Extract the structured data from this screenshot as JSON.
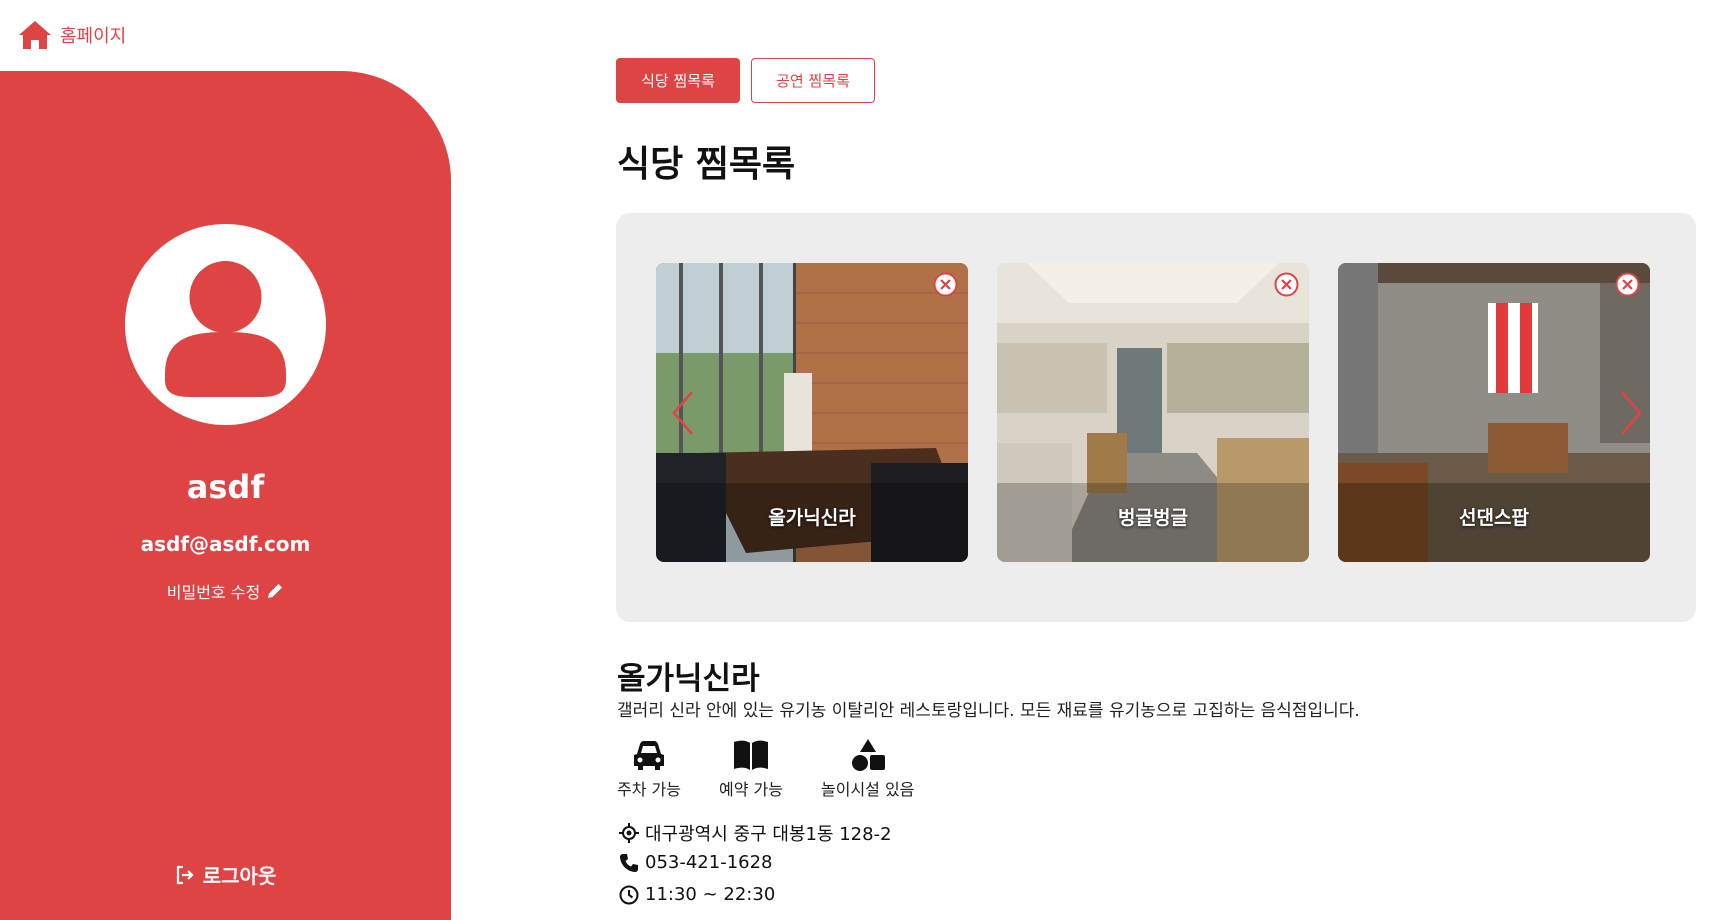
{
  "nav": {
    "home_label": "홈페이지",
    "home_icon": "home-icon",
    "accent_color": "#de4444"
  },
  "profile": {
    "username": "asdf",
    "email": "asdf@asdf.com",
    "edit_password_label": "비밀번호 수정",
    "edit_icon": "pencil-icon",
    "logout_label": "로그아웃",
    "logout_icon": "logout-icon",
    "avatar_icon": "user-avatar-icon"
  },
  "tabs": [
    {
      "label": "식당 찜목록",
      "active": true
    },
    {
      "label": "공연 찜목록",
      "active": false
    }
  ],
  "section_title": "식당 찜목록",
  "wishlist": [
    {
      "name": "올가닉신라"
    },
    {
      "name": "벙글벙글"
    },
    {
      "name": "선댄스팝"
    }
  ],
  "detail": {
    "name": "올가닉신라",
    "description": "갤러리 신라 안에 있는 유기농 이탈리안 레스토랑입니다. 모든 재료를 유기농으로 고집하는 음식점입니다.",
    "amenities": [
      {
        "label": "주차 가능",
        "icon": "car-icon"
      },
      {
        "label": "예약 가능",
        "icon": "book-icon"
      },
      {
        "label": "놀이시설 있음",
        "icon": "shapes-icon"
      }
    ],
    "address": "대구광역시 중구 대봉1동 128-2",
    "phone": "053-421-1628",
    "hours": "11:30 ~ 22:30"
  }
}
